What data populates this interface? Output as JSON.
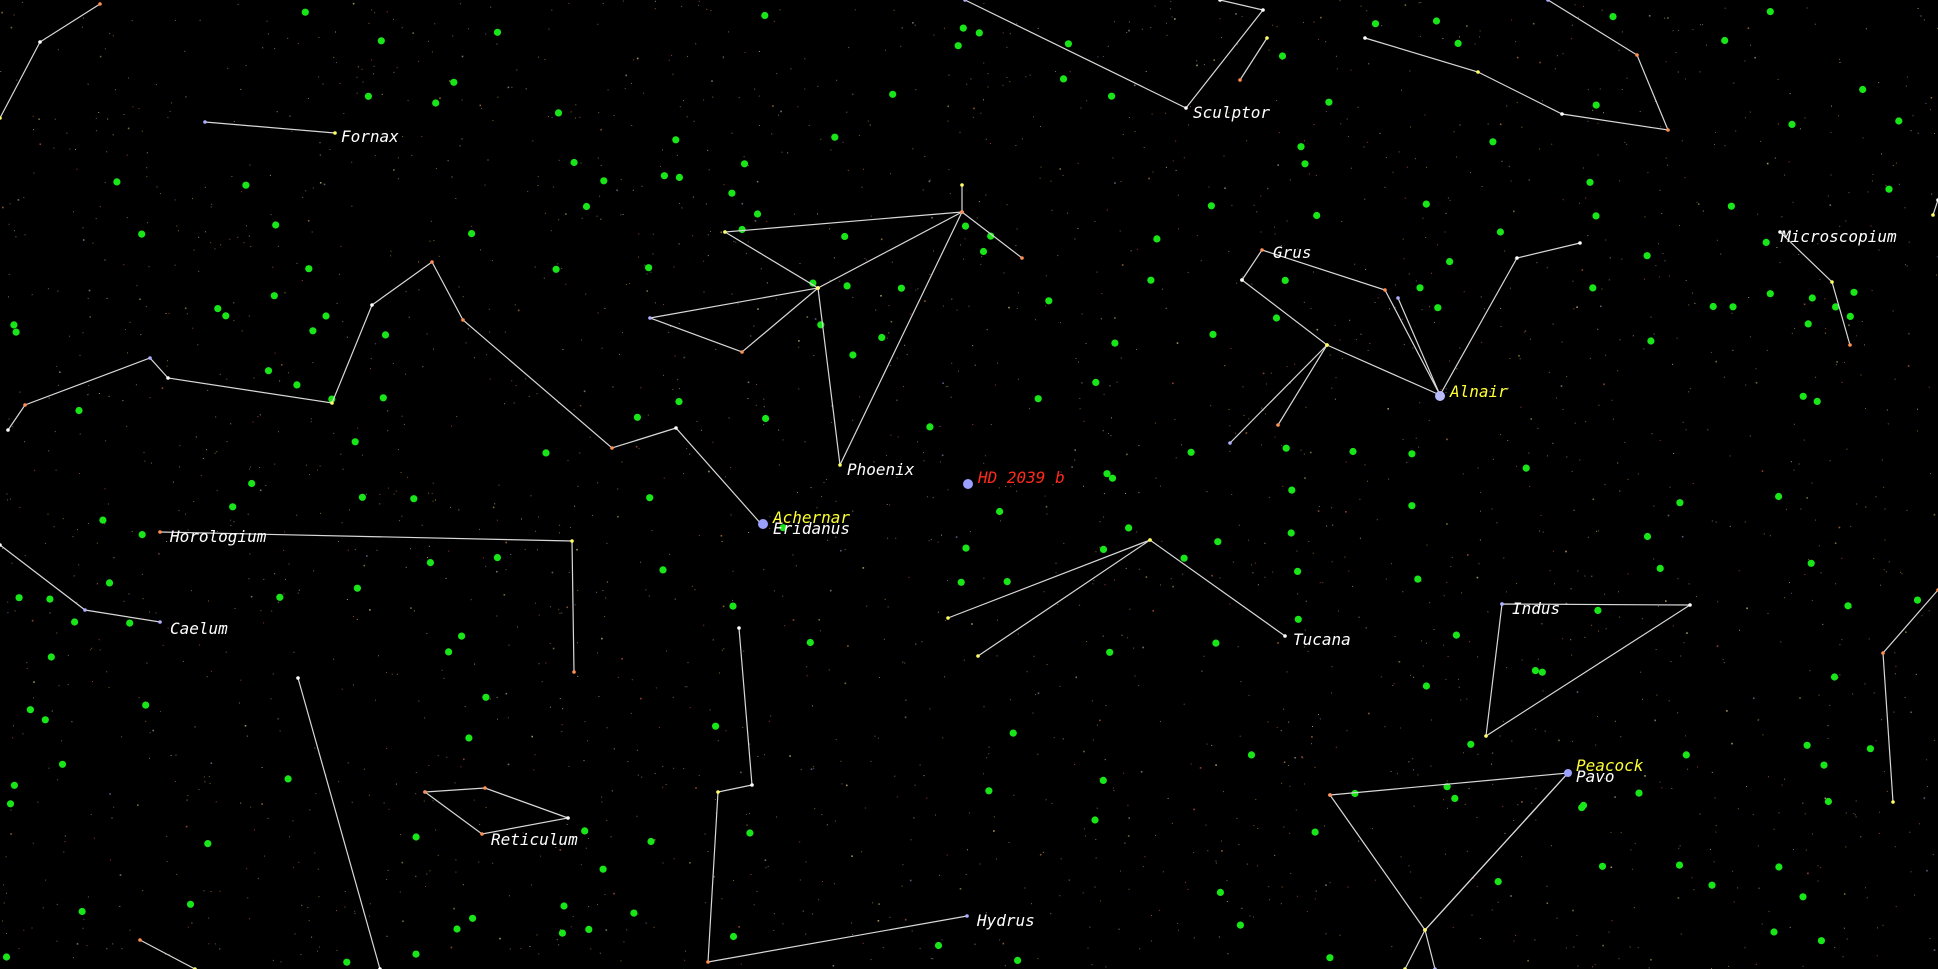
{
  "app": {
    "view": "southern sky star chart"
  },
  "colors": {
    "background": "#000000",
    "constellation_line": "#d8d8d8",
    "constellation_label": "#ffffff",
    "star_label": "#ffff33",
    "exoplanet_label": "#ff2a1a",
    "exoplanet_host_marker": "#9aa0ff",
    "exoplanet_field_dot": "#19e619"
  },
  "constellations": [
    {
      "id": "fornax",
      "label": "Fornax"
    },
    {
      "id": "sculptor",
      "label": "Sculptor"
    },
    {
      "id": "microscopium",
      "label": "Microscopium"
    },
    {
      "id": "grus",
      "label": "Grus"
    },
    {
      "id": "phoenix",
      "label": "Phoenix"
    },
    {
      "id": "horologium",
      "label": "Horologium"
    },
    {
      "id": "eridanus",
      "label": "Eridanus"
    },
    {
      "id": "caelum",
      "label": "Caelum"
    },
    {
      "id": "tucana",
      "label": "Tucana"
    },
    {
      "id": "indus",
      "label": "Indus"
    },
    {
      "id": "reticulum",
      "label": "Reticulum"
    },
    {
      "id": "hydrus",
      "label": "Hydrus"
    },
    {
      "id": "pavo",
      "label": "Pavo"
    }
  ],
  "named_stars": [
    {
      "id": "achernar",
      "label": "Achernar"
    },
    {
      "id": "alnair",
      "label": "Alnair"
    },
    {
      "id": "peacock",
      "label": "Peacock"
    }
  ],
  "highlighted_object": {
    "id": "hd-2039-b",
    "label": "HD 2039 b",
    "type": "exoplanet"
  },
  "icons": [
    "star-marker-icon",
    "exoplanet-marker-icon"
  ]
}
